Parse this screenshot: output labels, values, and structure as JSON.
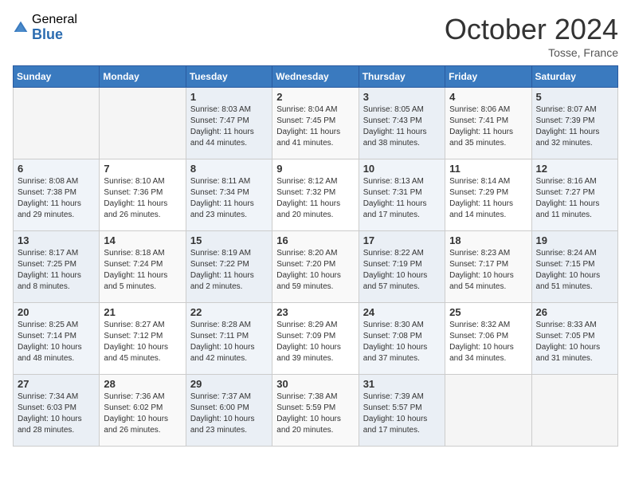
{
  "header": {
    "logo_general": "General",
    "logo_blue": "Blue",
    "month_title": "October 2024",
    "subtitle": "Tosse, France"
  },
  "weekdays": [
    "Sunday",
    "Monday",
    "Tuesday",
    "Wednesday",
    "Thursday",
    "Friday",
    "Saturday"
  ],
  "weeks": [
    [
      {
        "day": "",
        "info": ""
      },
      {
        "day": "",
        "info": ""
      },
      {
        "day": "1",
        "info": "Sunrise: 8:03 AM\nSunset: 7:47 PM\nDaylight: 11 hours and 44 minutes."
      },
      {
        "day": "2",
        "info": "Sunrise: 8:04 AM\nSunset: 7:45 PM\nDaylight: 11 hours and 41 minutes."
      },
      {
        "day": "3",
        "info": "Sunrise: 8:05 AM\nSunset: 7:43 PM\nDaylight: 11 hours and 38 minutes."
      },
      {
        "day": "4",
        "info": "Sunrise: 8:06 AM\nSunset: 7:41 PM\nDaylight: 11 hours and 35 minutes."
      },
      {
        "day": "5",
        "info": "Sunrise: 8:07 AM\nSunset: 7:39 PM\nDaylight: 11 hours and 32 minutes."
      }
    ],
    [
      {
        "day": "6",
        "info": "Sunrise: 8:08 AM\nSunset: 7:38 PM\nDaylight: 11 hours and 29 minutes."
      },
      {
        "day": "7",
        "info": "Sunrise: 8:10 AM\nSunset: 7:36 PM\nDaylight: 11 hours and 26 minutes."
      },
      {
        "day": "8",
        "info": "Sunrise: 8:11 AM\nSunset: 7:34 PM\nDaylight: 11 hours and 23 minutes."
      },
      {
        "day": "9",
        "info": "Sunrise: 8:12 AM\nSunset: 7:32 PM\nDaylight: 11 hours and 20 minutes."
      },
      {
        "day": "10",
        "info": "Sunrise: 8:13 AM\nSunset: 7:31 PM\nDaylight: 11 hours and 17 minutes."
      },
      {
        "day": "11",
        "info": "Sunrise: 8:14 AM\nSunset: 7:29 PM\nDaylight: 11 hours and 14 minutes."
      },
      {
        "day": "12",
        "info": "Sunrise: 8:16 AM\nSunset: 7:27 PM\nDaylight: 11 hours and 11 minutes."
      }
    ],
    [
      {
        "day": "13",
        "info": "Sunrise: 8:17 AM\nSunset: 7:25 PM\nDaylight: 11 hours and 8 minutes."
      },
      {
        "day": "14",
        "info": "Sunrise: 8:18 AM\nSunset: 7:24 PM\nDaylight: 11 hours and 5 minutes."
      },
      {
        "day": "15",
        "info": "Sunrise: 8:19 AM\nSunset: 7:22 PM\nDaylight: 11 hours and 2 minutes."
      },
      {
        "day": "16",
        "info": "Sunrise: 8:20 AM\nSunset: 7:20 PM\nDaylight: 10 hours and 59 minutes."
      },
      {
        "day": "17",
        "info": "Sunrise: 8:22 AM\nSunset: 7:19 PM\nDaylight: 10 hours and 57 minutes."
      },
      {
        "day": "18",
        "info": "Sunrise: 8:23 AM\nSunset: 7:17 PM\nDaylight: 10 hours and 54 minutes."
      },
      {
        "day": "19",
        "info": "Sunrise: 8:24 AM\nSunset: 7:15 PM\nDaylight: 10 hours and 51 minutes."
      }
    ],
    [
      {
        "day": "20",
        "info": "Sunrise: 8:25 AM\nSunset: 7:14 PM\nDaylight: 10 hours and 48 minutes."
      },
      {
        "day": "21",
        "info": "Sunrise: 8:27 AM\nSunset: 7:12 PM\nDaylight: 10 hours and 45 minutes."
      },
      {
        "day": "22",
        "info": "Sunrise: 8:28 AM\nSunset: 7:11 PM\nDaylight: 10 hours and 42 minutes."
      },
      {
        "day": "23",
        "info": "Sunrise: 8:29 AM\nSunset: 7:09 PM\nDaylight: 10 hours and 39 minutes."
      },
      {
        "day": "24",
        "info": "Sunrise: 8:30 AM\nSunset: 7:08 PM\nDaylight: 10 hours and 37 minutes."
      },
      {
        "day": "25",
        "info": "Sunrise: 8:32 AM\nSunset: 7:06 PM\nDaylight: 10 hours and 34 minutes."
      },
      {
        "day": "26",
        "info": "Sunrise: 8:33 AM\nSunset: 7:05 PM\nDaylight: 10 hours and 31 minutes."
      }
    ],
    [
      {
        "day": "27",
        "info": "Sunrise: 7:34 AM\nSunset: 6:03 PM\nDaylight: 10 hours and 28 minutes."
      },
      {
        "day": "28",
        "info": "Sunrise: 7:36 AM\nSunset: 6:02 PM\nDaylight: 10 hours and 26 minutes."
      },
      {
        "day": "29",
        "info": "Sunrise: 7:37 AM\nSunset: 6:00 PM\nDaylight: 10 hours and 23 minutes."
      },
      {
        "day": "30",
        "info": "Sunrise: 7:38 AM\nSunset: 5:59 PM\nDaylight: 10 hours and 20 minutes."
      },
      {
        "day": "31",
        "info": "Sunrise: 7:39 AM\nSunset: 5:57 PM\nDaylight: 10 hours and 17 minutes."
      },
      {
        "day": "",
        "info": ""
      },
      {
        "day": "",
        "info": ""
      }
    ]
  ]
}
